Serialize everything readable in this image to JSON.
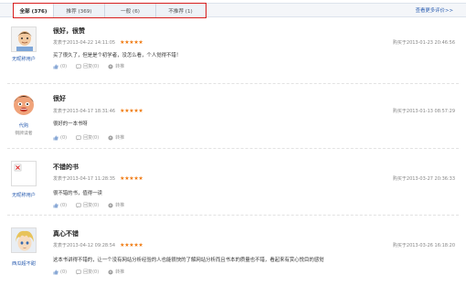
{
  "tabs": [
    {
      "label": "全部 (376)",
      "active": true
    },
    {
      "label": "推荐 (369)",
      "active": false
    },
    {
      "label": "一般 (6)",
      "active": false
    },
    {
      "label": "不推荐 (1)",
      "active": false
    }
  ],
  "more_link": "查看更多评价>>",
  "colors": {
    "highlight_border": "#d81e1e",
    "link": "#2a5db0",
    "star": "#f07a10"
  },
  "reviews": [
    {
      "username": "无昵称用户",
      "level": "",
      "title": "很好，很赞",
      "posted": "发表于2013-04-22 14:11:05",
      "stars": "★★★★★",
      "text": "买了很久了，但是是个初学者，没怎么看，个人觉得不错！",
      "like": "(0)",
      "reply": "回复(0)",
      "share": "转推",
      "bought": "购买于2013-01-23 20:46:56",
      "avatar_icon": "default-face-avatar-icon"
    },
    {
      "username": "代购",
      "level": "铜牌读者",
      "title": "很好",
      "posted": "发表于2013-04-17 18:31:46",
      "stars": "★★★★★",
      "text": "很好的一本书呀",
      "like": "(0)",
      "reply": "回复(0)",
      "share": "转推",
      "bought": "购买于2013-01-13 08:57:29",
      "avatar_icon": "cartoon-face-avatar-icon"
    },
    {
      "username": "无昵称用户",
      "level": "",
      "title": "不错的书",
      "posted": "发表于2013-04-17 11:28:35",
      "stars": "★★★★★",
      "text": "很不错的书，值得一读",
      "like": "(0)",
      "reply": "回复(0)",
      "share": "转推",
      "bought": "购买于2013-03-27 20:36:33",
      "avatar_icon": "broken-image-avatar-icon"
    },
    {
      "username": "西瓜超不甜",
      "level": "",
      "title": "真心不错",
      "posted": "发表于2013-04-12 09:28:54",
      "stars": "★★★★★",
      "text": "这本书讲得不错的，让一个没有网站分析经验的人也能很快的了解网站分析而且书本的质量也不错，看起来有赏心悦目的感觉",
      "like": "(0)",
      "reply": "回复(0)",
      "share": "转推",
      "bought": "购买于2013-03-26 16:18:20",
      "avatar_icon": "anime-boy-avatar-icon"
    }
  ]
}
